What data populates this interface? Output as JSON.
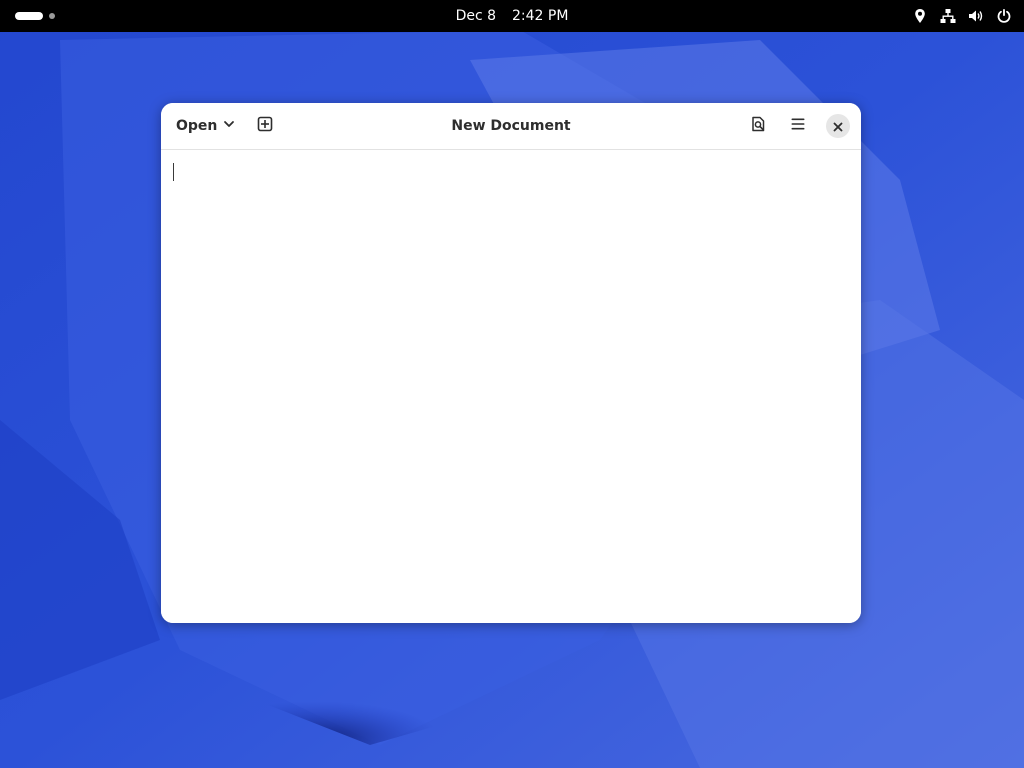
{
  "topbar": {
    "date": "Dec 8",
    "time": "2:42 PM",
    "icons": [
      "location-icon",
      "network-icon",
      "volume-icon",
      "power-icon"
    ]
  },
  "window": {
    "title": "New Document",
    "open_label": "Open",
    "icons": [
      "chevron-down-icon",
      "new-tab-icon",
      "search-document-icon",
      "hamburger-menu-icon",
      "close-icon"
    ]
  },
  "editor": {
    "content": ""
  },
  "colors": {
    "wallpaper": "#2a4fd3",
    "topbar": "#000000",
    "window_bg": "#ffffff"
  }
}
